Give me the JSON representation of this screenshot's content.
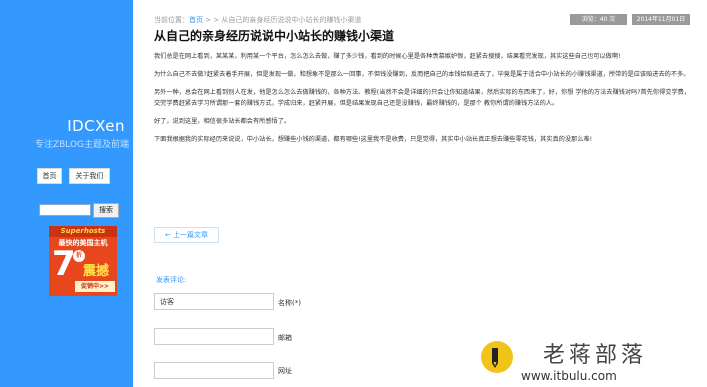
{
  "sidebar": {
    "site_title": "IDCXen",
    "site_subtitle": "专注ZBLOG主题及前端",
    "nav": [
      {
        "label": "首页"
      },
      {
        "label": "关于我们"
      }
    ],
    "search": {
      "value": "",
      "button_label": "搜索"
    },
    "ad": {
      "top_text": "Superhosts",
      "line1": "最快的美国主机",
      "big_number": "7",
      "badge": "折",
      "shock_text": "震撼",
      "promo_text": "促销中>>"
    }
  },
  "breadcrumb": {
    "prefix": "当前位置：",
    "home": "首页",
    "separator": " > > ",
    "current": "从自己的亲身经历说说中小站长的赚钱小渠道"
  },
  "meta": {
    "views": "浏览：40 次",
    "date": "2014年11月01日"
  },
  "post": {
    "title": "从自己的亲身经历说说中小站长的赚钱小渠道",
    "paragraphs": [
      "我们总是在网上看到，某某某，利用某一个平台，怎么怎么去做，赚了多少钱，看到的时候心里是各种羡慕嫉妒恨，赶紧去搜搜，结果看完发现，其实这些自己也可以做啊!",
      "为什么自己不去做?赶紧去着手开展，但是发现一做，和想象不是那么一回事，不但钱没赚到，反而把自己的本钱给赔进去了，毕竟是属于适合中小站长的小赚钱渠道，所带的是应该赔进去的不多。",
      "另外一种，总会在网上看到别人在发，他是怎么怎么去做赚钱的，各种方法、教程(当然不会是详细的)只会让你知道结果，然后实际的东西来了，好，你想 学他的方法去赚钱对吗?首先你得交学费，交完学费赶紧去学习所谓那一套的赚钱方式，学成归来，赶紧开展，但是结果发现自己还是没赚钱，最终赚钱的，是那个 教你所谓的赚钱方法的人。",
      "好了，说到这里，相信很多站长都会有所感悟了。",
      "下面我根据我的实际经历来说说，中小站长，想赚些小钱的渠道，都有哪些!这里我不是收费，只是觉得，其实中小站长真正想去赚些零花钱，其实真的没那么难!"
    ],
    "prev_link": "← 上一篇文章"
  },
  "comment": {
    "heading": "发表评论:",
    "name_value": "访客",
    "name_label": "名称(*)",
    "email_value": "",
    "email_label": "邮箱",
    "url_value": "",
    "url_label": "网址"
  },
  "watermark": {
    "title": "老蒋部落",
    "url": "www.itbulu.com"
  }
}
